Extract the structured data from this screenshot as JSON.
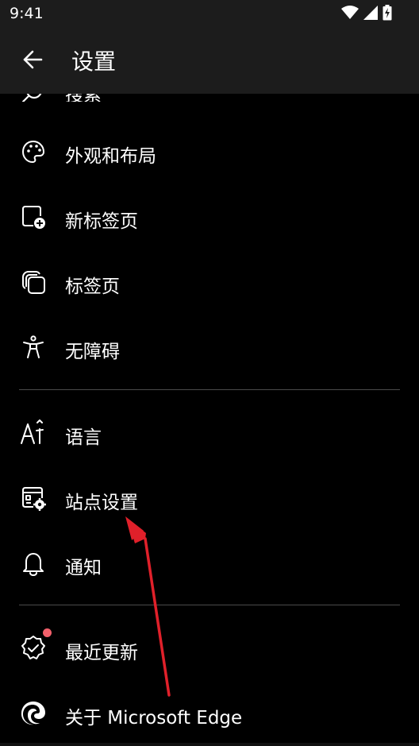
{
  "status_bar": {
    "time": "9:41",
    "icons": [
      "wifi-icon",
      "cell-signal-icon",
      "battery-charging-icon"
    ]
  },
  "app_bar": {
    "title": "设置",
    "back_icon": "arrow-left-icon"
  },
  "partial_item": {
    "label": "搜索",
    "icon": "search-icon"
  },
  "sections": [
    {
      "items": [
        {
          "label": "外观和布局",
          "icon": "palette-icon"
        },
        {
          "label": "新标签页",
          "icon": "new-tab-icon"
        },
        {
          "label": "标签页",
          "icon": "tabs-icon"
        },
        {
          "label": "无障碍",
          "icon": "accessibility-icon"
        }
      ]
    },
    {
      "items": [
        {
          "label": "语言",
          "icon": "language-icon"
        },
        {
          "label": "站点设置",
          "icon": "site-settings-icon"
        },
        {
          "label": "通知",
          "icon": "bell-icon"
        }
      ]
    },
    {
      "items": [
        {
          "label": "最近更新",
          "icon": "badge-check-icon",
          "has_badge": true
        },
        {
          "label": "关于 Microsoft Edge",
          "icon": "edge-logo-icon"
        }
      ]
    }
  ],
  "colors": {
    "background": "#000000",
    "app_bar": "#1c1c1c",
    "divider": "#4a4a4a",
    "badge": "#f2606b",
    "annotation_arrow": "#e0202a"
  }
}
